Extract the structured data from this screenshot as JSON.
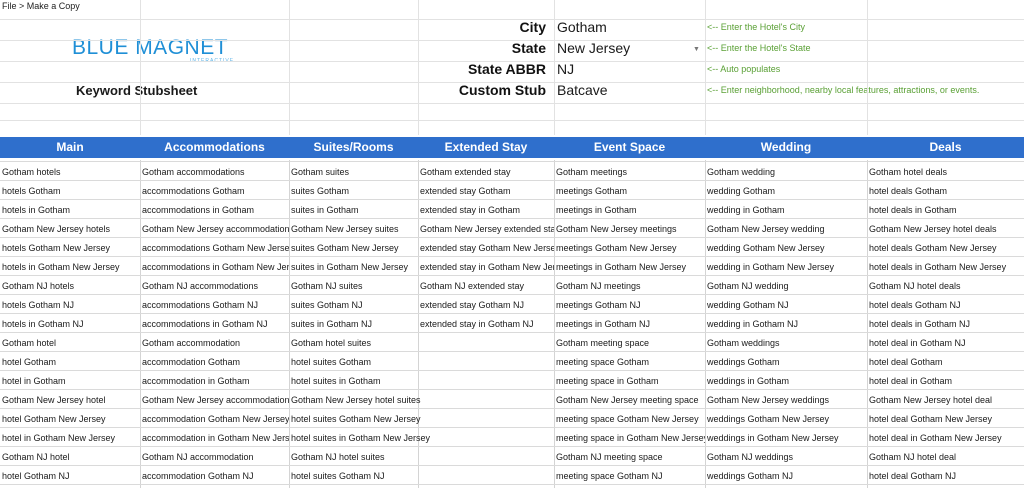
{
  "menu_hint": "File > Make a Copy",
  "logo": {
    "text": "BLUE MAGNET",
    "sub": "INTERACTIVE"
  },
  "sheet_title": "Keyword Stubsheet",
  "params": [
    {
      "label": "City",
      "value": "Gotham",
      "note": "<-- Enter the Hotel's City"
    },
    {
      "label": "State",
      "value": "New Jersey",
      "note": "<-- Enter the Hotel's State"
    },
    {
      "label": "State ABBR",
      "value": "NJ",
      "note": "<-- Auto populates"
    },
    {
      "label": "Custom Stub",
      "value": "Batcave",
      "note": "<-- Enter neighborhood, nearby local features, attractions, or events."
    }
  ],
  "columns": [
    "Main",
    "Accommodations",
    "Suites/Rooms",
    "Extended Stay",
    "Event Space",
    "Wedding",
    "Deals"
  ],
  "rows": [
    [
      "Gotham hotels",
      "Gotham accommodations",
      "Gotham suites",
      "Gotham extended stay",
      "Gotham meetings",
      "Gotham wedding",
      "Gotham hotel deals"
    ],
    [
      "hotels Gotham",
      "accommodations Gotham",
      "suites Gotham",
      "extended stay Gotham",
      "meetings Gotham",
      "wedding Gotham",
      "hotel deals Gotham"
    ],
    [
      "hotels in Gotham",
      "accommodations in Gotham",
      "suites in Gotham",
      "extended stay in Gotham",
      "meetings in Gotham",
      "wedding in Gotham",
      "hotel deals in Gotham"
    ],
    [
      "Gotham New Jersey hotels",
      "Gotham New Jersey accommodations",
      "Gotham New Jersey suites",
      "Gotham New Jersey extended stay",
      "Gotham New Jersey meetings",
      "Gotham New Jersey wedding",
      "Gotham New Jersey hotel deals"
    ],
    [
      "hotels Gotham New Jersey",
      "accommodations Gotham New Jersey",
      "suites Gotham New Jersey",
      "extended stay Gotham New Jersey",
      "meetings Gotham New Jersey",
      "wedding Gotham New Jersey",
      "hotel deals Gotham New Jersey"
    ],
    [
      "hotels in Gotham New Jersey",
      "accommodations in Gotham New Jersey",
      "suites in Gotham New Jersey",
      "extended stay in Gotham New Jersey",
      "meetings in Gotham New Jersey",
      "wedding in Gotham New Jersey",
      "hotel deals in Gotham New Jersey"
    ],
    [
      "Gotham NJ hotels",
      "Gotham NJ accommodations",
      "Gotham NJ suites",
      "Gotham NJ extended stay",
      "Gotham NJ meetings",
      "Gotham NJ wedding",
      "Gotham NJ hotel deals"
    ],
    [
      "hotels Gotham NJ",
      "accommodations Gotham NJ",
      "suites Gotham NJ",
      "extended stay Gotham NJ",
      "meetings Gotham NJ",
      "wedding Gotham NJ",
      "hotel deals Gotham NJ"
    ],
    [
      "hotels in Gotham NJ",
      "accommodations in Gotham NJ",
      "suites in Gotham NJ",
      "extended stay in Gotham NJ",
      "meetings in Gotham NJ",
      "wedding in Gotham NJ",
      "hotel deals in Gotham NJ"
    ],
    [
      "Gotham hotel",
      "Gotham accommodation",
      "Gotham hotel suites",
      "",
      "Gotham meeting space",
      "Gotham weddings",
      "hotel deal in Gotham NJ"
    ],
    [
      "hotel Gotham",
      "accommodation Gotham",
      "hotel suites Gotham",
      "",
      "meeting space Gotham",
      "weddings Gotham",
      "hotel deal Gotham"
    ],
    [
      "hotel in Gotham",
      "accommodation in Gotham",
      "hotel suites in Gotham",
      "",
      "meeting space in Gotham",
      "weddings in Gotham",
      "hotel deal in Gotham"
    ],
    [
      "Gotham New Jersey hotel",
      "Gotham New Jersey accommodation",
      "Gotham New Jersey hotel suites",
      "",
      "Gotham New Jersey meeting space",
      "Gotham New Jersey weddings",
      "Gotham New Jersey hotel deal"
    ],
    [
      "hotel Gotham New Jersey",
      "accommodation Gotham New Jersey",
      "hotel suites Gotham New Jersey",
      "",
      "meeting space Gotham New Jersey",
      "weddings Gotham New Jersey",
      "hotel deal Gotham New Jersey"
    ],
    [
      "hotel in Gotham New Jersey",
      "accommodation in Gotham New Jersey",
      "hotel suites in Gotham New Jersey",
      "",
      "meeting space in Gotham New Jersey",
      "weddings in Gotham New Jersey",
      "hotel deal in Gotham New Jersey"
    ],
    [
      "Gotham NJ hotel",
      "Gotham NJ accommodation",
      "Gotham NJ hotel suites",
      "",
      "Gotham NJ meeting space",
      "Gotham NJ weddings",
      "Gotham NJ hotel deal"
    ],
    [
      "hotel Gotham NJ",
      "accommodation Gotham NJ",
      "hotel suites Gotham NJ",
      "",
      "meeting space Gotham NJ",
      "weddings Gotham NJ",
      "hotel deal Gotham NJ"
    ]
  ],
  "colors": {
    "header_blue": "#2f6fcc",
    "logo_blue": "#1f8fd6",
    "note_green": "#5aa035"
  }
}
